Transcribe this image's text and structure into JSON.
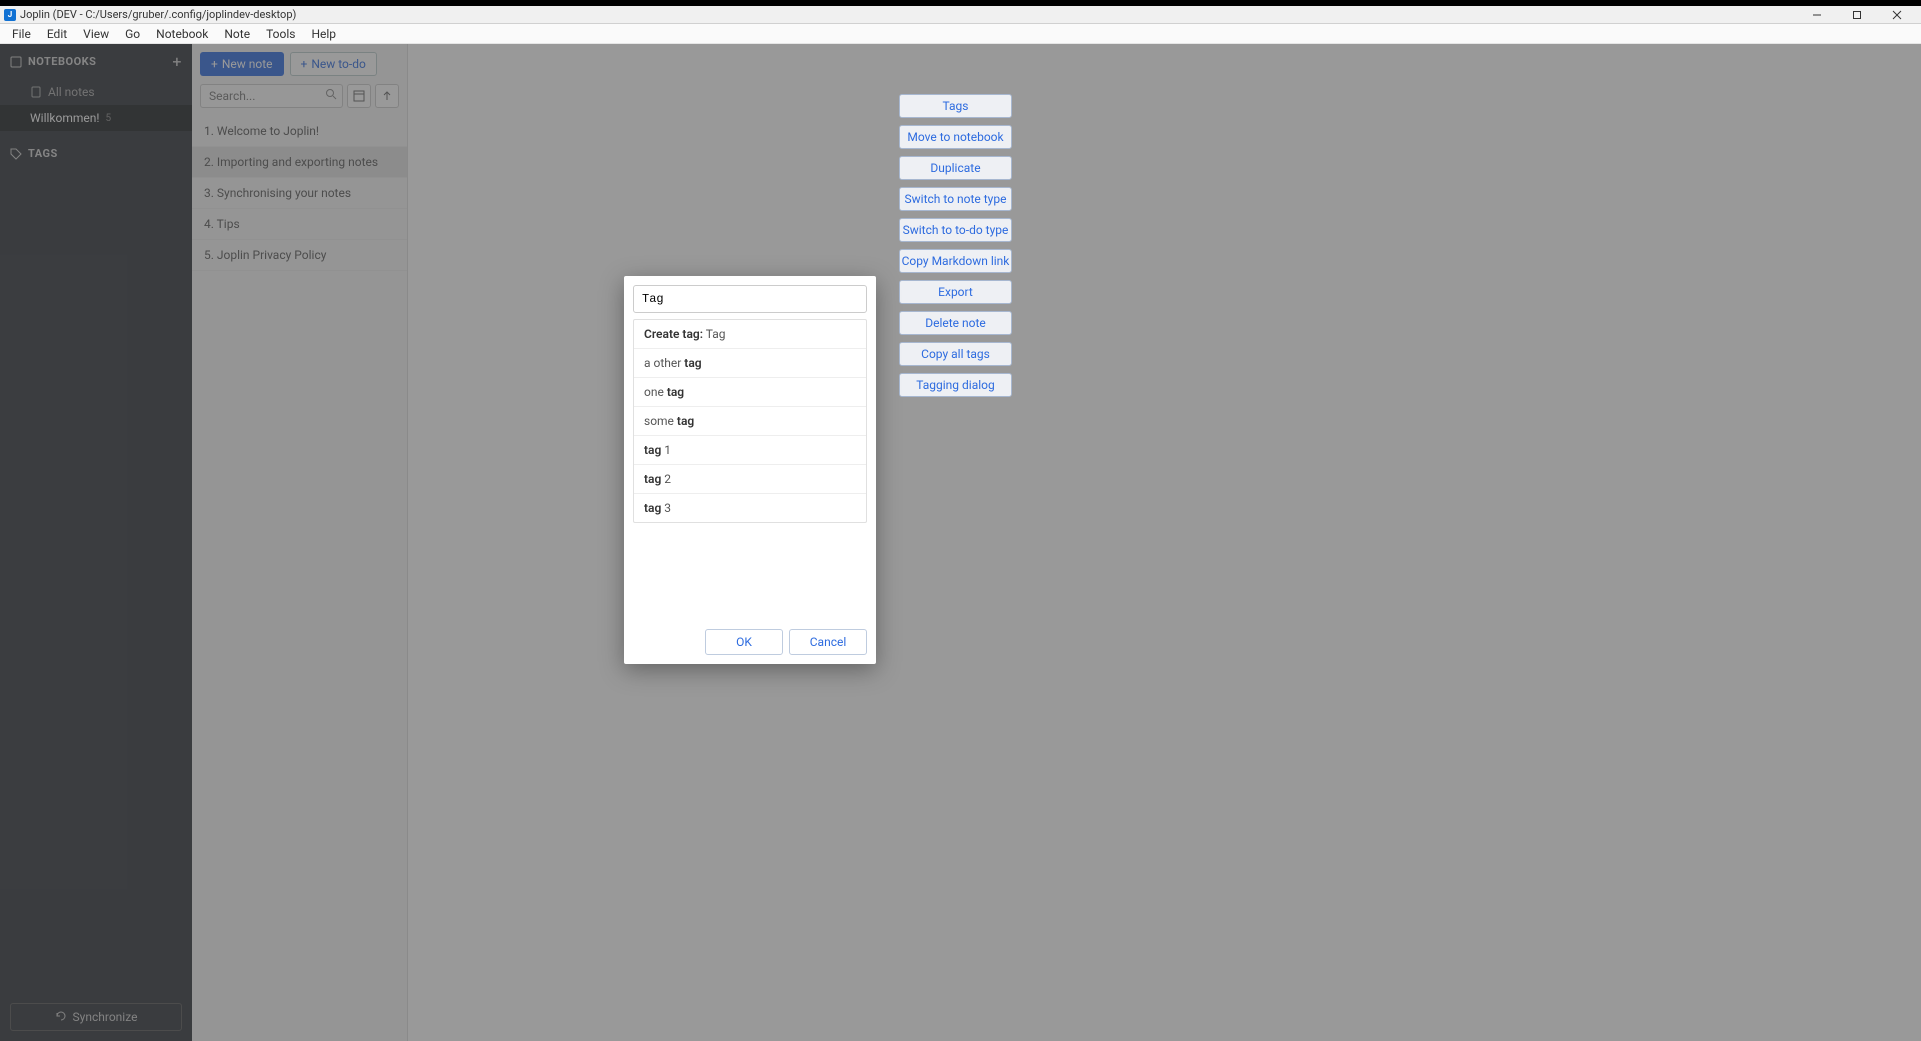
{
  "window": {
    "title": "Joplin (DEV - C:/Users/gruber/.config/joplindev-desktop)"
  },
  "menubar": [
    "File",
    "Edit",
    "View",
    "Go",
    "Notebook",
    "Note",
    "Tools",
    "Help"
  ],
  "sidebar": {
    "notebooks_label": "NOTEBOOKS",
    "all_notes_label": "All notes",
    "notebooks": [
      {
        "label": "Willkommen!",
        "count": "5",
        "selected": true
      }
    ],
    "tags_label": "TAGS",
    "sync_label": "Synchronize"
  },
  "notelist": {
    "new_note_label": "New note",
    "new_todo_label": "New to-do",
    "search_placeholder": "Search...",
    "notes": [
      {
        "label": "1. Welcome to Joplin!"
      },
      {
        "label": "2. Importing and exporting notes",
        "selected": true
      },
      {
        "label": "3. Synchronising your notes"
      },
      {
        "label": "4. Tips"
      },
      {
        "label": "5. Joplin Privacy Policy"
      }
    ]
  },
  "context_menu": [
    "Tags",
    "Move to notebook",
    "Duplicate",
    "Switch to note type",
    "Switch to to-do type",
    "Copy Markdown link",
    "Export",
    "Delete note",
    "Copy all tags",
    "Tagging dialog"
  ],
  "modal": {
    "input_value": "Tag",
    "create_prefix": "Create tag:",
    "create_value": "Tag",
    "suggestions": [
      {
        "pre": "a other ",
        "match": "tag",
        "post": ""
      },
      {
        "pre": "one ",
        "match": "tag",
        "post": ""
      },
      {
        "pre": "some ",
        "match": "tag",
        "post": ""
      },
      {
        "pre": "",
        "match": "tag",
        "post": " 1"
      },
      {
        "pre": "",
        "match": "tag",
        "post": " 2"
      },
      {
        "pre": "",
        "match": "tag",
        "post": " 3"
      }
    ],
    "ok_label": "OK",
    "cancel_label": "Cancel"
  }
}
